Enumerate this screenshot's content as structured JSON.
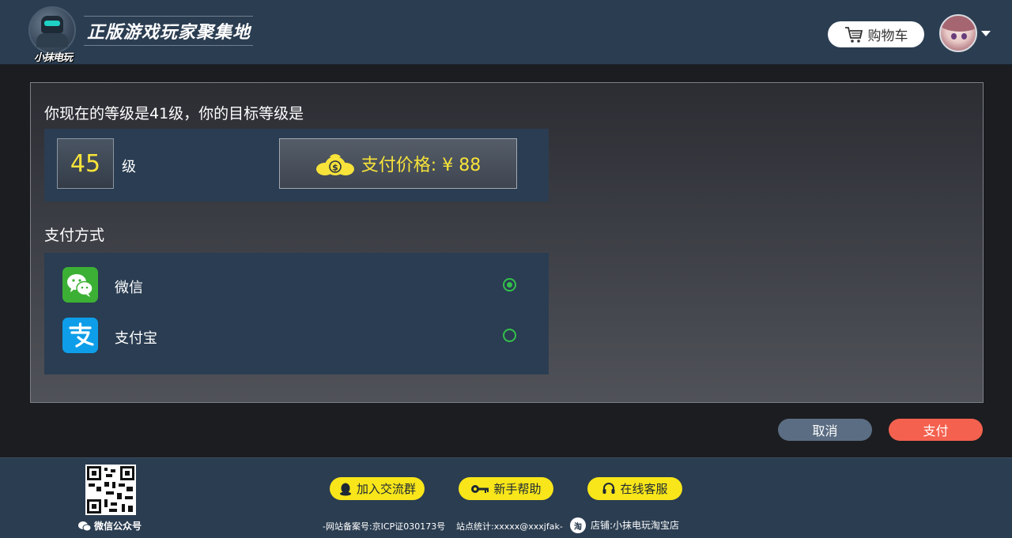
{
  "header": {
    "logo_text": "小抹电玩",
    "slogan": "正版游戏玩家聚集地",
    "cart_label": "购物车",
    "cart_icon": "cart-icon",
    "avatar_icon": "avatar",
    "caret_icon": "caret-down-icon"
  },
  "level": {
    "title": "你现在的等级是41级，你的目标等级是",
    "target_value": "45",
    "unit": "级",
    "price_label": "支付价格: ¥ 88",
    "price_icon": "money-bag-icon"
  },
  "payment": {
    "title": "支付方式",
    "methods": [
      {
        "label": "微信",
        "icon": "wechat-icon",
        "selected": true
      },
      {
        "label": "支付宝",
        "icon": "alipay-icon",
        "selected": false
      }
    ]
  },
  "actions": {
    "cancel_label": "取消",
    "pay_label": "支付"
  },
  "footer": {
    "qr_label": "微信公众号",
    "join_group": "加入交流群",
    "help": "新手帮助",
    "service": "在线客服",
    "icp": "-网站备案号:京ICP证030173号",
    "stats": "站点统计:xxxxx@xxxjfak-",
    "shop_badge": "淘",
    "shop": "店铺:小抹电玩淘宝店"
  },
  "colors": {
    "header_bg": "#2b3d51",
    "accent_yellow": "#f7e33a",
    "pay_button": "#f4614f",
    "cancel_button": "#5b6d83",
    "radio_green": "#33c04b"
  }
}
